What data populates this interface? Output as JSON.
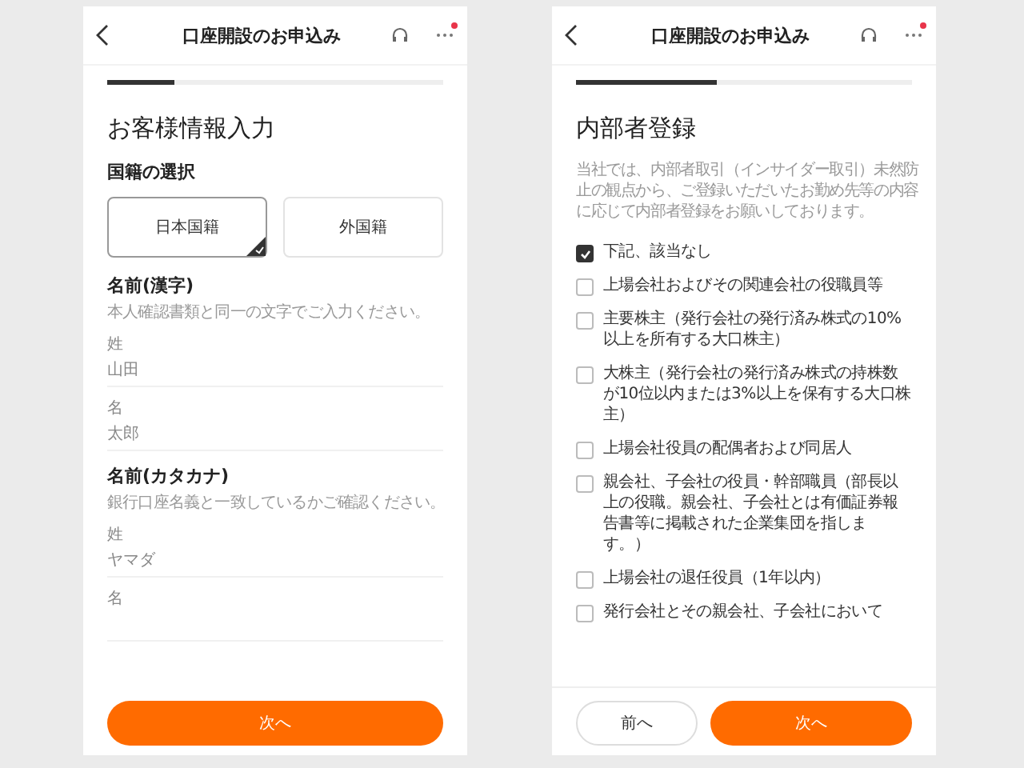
{
  "screens": [
    {
      "kind": "form",
      "header": {
        "title": "口座開設のお申込み",
        "notification": true
      },
      "progress": {
        "level": 0.2
      },
      "heading": "お客様情報入力",
      "nationality": {
        "label": "国籍の選択",
        "options": [
          {
            "label": "日本国籍",
            "selected": true
          },
          {
            "label": "外国籍",
            "selected": false
          }
        ]
      },
      "sections": [
        {
          "title": "名前(漢字)",
          "note": "本人確認書類と同一の文字でご入力ください。",
          "fields": [
            {
              "label": "姓",
              "value": "山田"
            },
            {
              "label": "名",
              "value": "太郎"
            }
          ]
        },
        {
          "title": "名前(カタカナ)",
          "note": "銀行口座名義と一致しているかご確認ください。",
          "fields": [
            {
              "label": "姓",
              "value": "ヤマダ"
            },
            {
              "label": "名"
            }
          ]
        }
      ],
      "buttons": [
        {
          "label": "次へ",
          "kind": "primary"
        }
      ]
    },
    {
      "kind": "checklist",
      "header": {
        "title": "口座開設のお申込み",
        "notification": true
      },
      "progress": {
        "level": 0.42
      },
      "heading": "内部者登録",
      "note": "当社では、内部者取引（インサイダー取引）未然防止の観点から、ご登録いただいたお勤め先等の内容に応じて内部者登録をお願いしております。",
      "options": [
        {
          "label": "下記、該当なし",
          "checked": true
        },
        {
          "label": "上場会社およびその関連会社の役職員等",
          "checked": false
        },
        {
          "label": "主要株主（発行会社の発行済み株式の10%以上を所有する大口株主）",
          "checked": false
        },
        {
          "label": "大株主（発行会社の発行済み株式の持株数が10位以内または3%以上を保有する大口株主）",
          "checked": false
        },
        {
          "label": "上場会社役員の配偶者および同居人",
          "checked": false
        },
        {
          "label": "親会社、子会社の役員・幹部職員（部長以上の役職。親会社、子会社とは有価証券報告書等に掲載された企業集団を指します。）",
          "checked": false
        },
        {
          "label": "上場会社の退任役員（1年以内）",
          "checked": false
        },
        {
          "label": "発行会社とその親会社、子会社において",
          "checked": false
        }
      ],
      "buttons": [
        {
          "label": "前へ",
          "kind": "secondary"
        },
        {
          "label": "次へ",
          "kind": "primary"
        }
      ]
    }
  ]
}
